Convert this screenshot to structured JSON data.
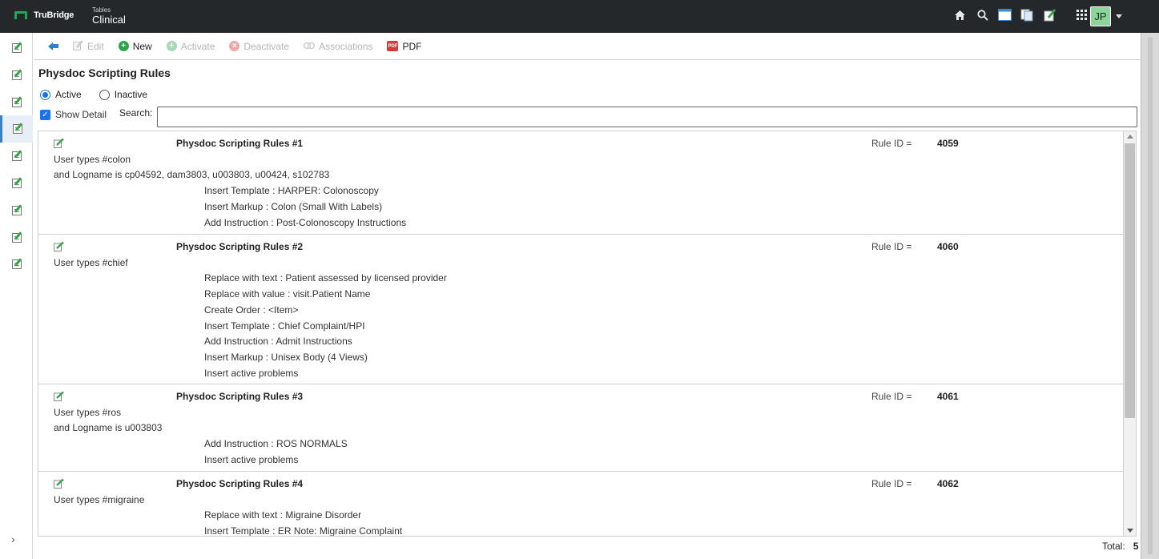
{
  "header": {
    "brand": "TruBridge",
    "app_small": "Tables",
    "app_title": "Clinical",
    "user_initials": "JP"
  },
  "toolbar": {
    "edit_label": "Edit",
    "new_label": "New",
    "activate_label": "Activate",
    "deactivate_label": "Deactivate",
    "associations_label": "Associations",
    "pdf_label": "PDF"
  },
  "page": {
    "title": "Physdoc Scripting Rules",
    "active_label": "Active",
    "inactive_label": "Inactive",
    "show_detail_label": "Show Detail",
    "search_label": "Search:",
    "search_value": "",
    "total_label": "Total:",
    "total_value": "5"
  },
  "rules": [
    {
      "title": "Physdoc Scripting Rules #1",
      "rule_id_label": "Rule ID =",
      "rule_id": "4059",
      "conditions": [
        "User types #colon",
        "and Logname is cp04592, dam3803, u003803, u00424, s102783"
      ],
      "actions": [
        "Insert Template : HARPER: Colonoscopy",
        "Insert Markup : Colon (Small With Labels)",
        "Add Instruction : Post-Colonoscopy Instructions"
      ]
    },
    {
      "title": "Physdoc Scripting Rules #2",
      "rule_id_label": "Rule ID =",
      "rule_id": "4060",
      "conditions": [
        "User types #chief"
      ],
      "actions": [
        "Replace with text : Patient assessed by licensed provider",
        "Replace with value : visit.Patient Name",
        "Create Order : <Item>",
        "Insert Template : Chief Complaint/HPI",
        "Add Instruction : Admit Instructions",
        "Insert Markup : Unisex Body (4 Views)",
        "Insert active problems"
      ]
    },
    {
      "title": "Physdoc Scripting Rules #3",
      "rule_id_label": "Rule ID =",
      "rule_id": "4061",
      "conditions": [
        "User types #ros",
        "and Logname is u003803"
      ],
      "actions": [
        "Add Instruction : ROS NORMALS",
        "Insert active problems"
      ]
    },
    {
      "title": "Physdoc Scripting Rules #4",
      "rule_id_label": "Rule ID =",
      "rule_id": "4062",
      "conditions": [
        "User types #migraine"
      ],
      "actions": [
        "Replace with text : Migraine Disorder",
        "Insert Template : ER Note: Migraine Complaint"
      ]
    }
  ]
}
